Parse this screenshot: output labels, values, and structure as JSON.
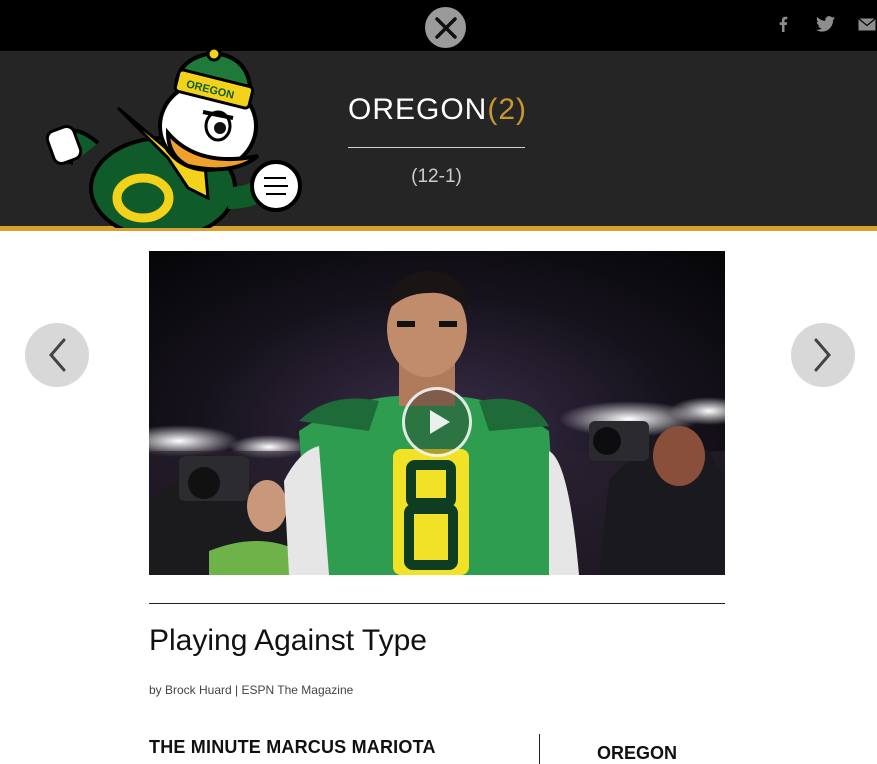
{
  "topbar": {
    "close_icon": "close-icon",
    "share": [
      {
        "name": "facebook-icon"
      },
      {
        "name": "twitter-icon"
      },
      {
        "name": "email-icon"
      }
    ]
  },
  "header": {
    "team_name": "OREGON",
    "rank": "(2)",
    "record": "(12-1)",
    "mascot_text": "OREGON",
    "colors": {
      "background": "#252525",
      "gold": "#d6a12c",
      "green": "#1f7a3a",
      "yellow": "#f2d21b"
    }
  },
  "carousel": {
    "prev_icon": "chevron-left-icon",
    "next_icon": "chevron-right-icon",
    "play_icon": "play-icon",
    "jersey_number": "8"
  },
  "article": {
    "headline": "Playing Against Type",
    "byline": "by Brock Huard | ESPN The Magazine",
    "subhead": "THE MINUTE MARCUS MARIOTA",
    "sidebar_team": "OREGON"
  }
}
